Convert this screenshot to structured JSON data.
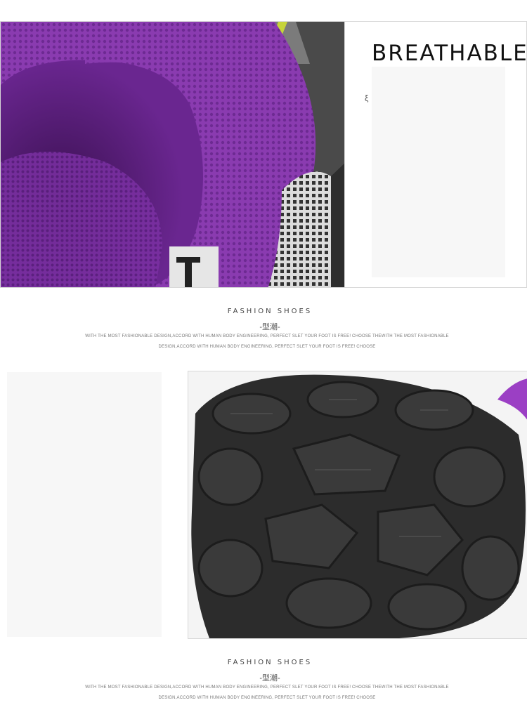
{
  "feature": {
    "heading": "BREATHABLE",
    "cut_off_char": "ξ"
  },
  "captions": [
    {
      "title": "FASHION SHOES",
      "subtitle": "-型潮-",
      "body": "WITH THE MOST FASHIONABLE DESIGN,ACCORD WITH HUMAN BODY ENGINEERING, PERFECT SLET YOUR FOOT IS FREE! CHOOSE THEWITH THE MOST FASHIONABLE DESIGN,ACCORD WITH HUMAN BODY ENGINEERING, PERFECT SLET YOUR FOOT IS FREE! CHOOSE"
    },
    {
      "title": "FASHION SHOES",
      "subtitle": "-型潮-",
      "body": "WITH THE MOST FASHIONABLE DESIGN,ACCORD WITH HUMAN BODY ENGINEERING, PERFECT SLET YOUR FOOT IS FREE! CHOOSE THEWITH THE MOST FASHIONABLE DESIGN,ACCORD WITH HUMAN BODY ENGINEERING, PERFECT SLET YOUR FOOT IS FREE! CHOOSE"
    }
  ],
  "colors": {
    "fabric_purple": "#7a2f9c",
    "fabric_dark": "#4a1a62",
    "mesh_gray": "#c9c9c9",
    "sole_black": "#2c2c2c",
    "accent_lime": "#c6d43a"
  }
}
